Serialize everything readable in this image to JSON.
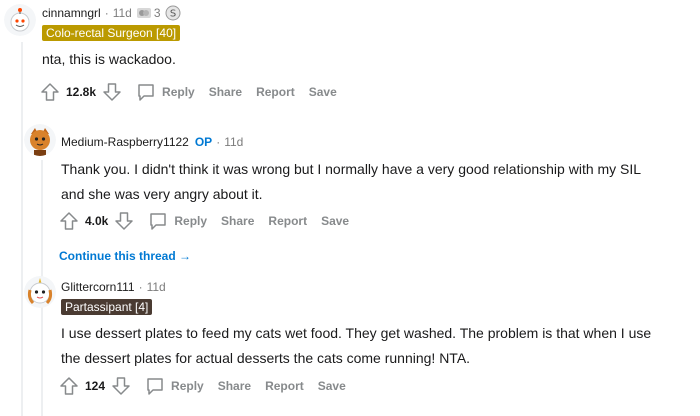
{
  "comments": [
    {
      "username": "cinnamngrl",
      "time": "11d",
      "award_count": "3",
      "flair": "Colo-rectal Surgeon [40]",
      "flair_color": "#bb9a00",
      "body": "nta, this is wackadoo.",
      "votes": "12.8k",
      "reply": "Reply",
      "share": "Share",
      "report": "Report",
      "save": "Save"
    },
    {
      "username": "Medium-Raspberry1122",
      "op": "OP",
      "time": "11d",
      "body_line1": "Thank you. I didn't think it was wrong but I normally have a very good relationship with my SIL",
      "body_line2": "and she was very angry about it.",
      "votes": "4.0k",
      "reply": "Reply",
      "share": "Share",
      "report": "Report",
      "save": "Save",
      "continue": "Continue this thread →"
    },
    {
      "username": "Glittercorn111",
      "time": "11d",
      "flair": "Partassipant [4]",
      "flair_color": "#4a3b32",
      "body_line1": "I use dessert plates to feed my cats wet food. They get washed. The problem is that when I use",
      "body_line2": "the dessert plates for actual desserts the cats come running! NTA.",
      "votes": "124",
      "reply": "Reply",
      "share": "Share",
      "report": "Report",
      "save": "Save"
    }
  ],
  "colors": {
    "op": "#0079d3",
    "meta": "#7c7c7c",
    "action": "#878a8c",
    "thread_line": "#edeff1"
  }
}
